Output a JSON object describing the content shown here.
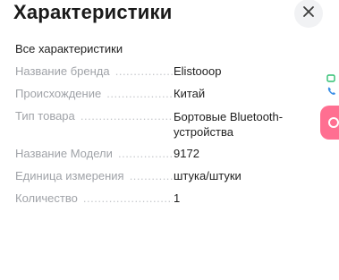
{
  "header": {
    "title": "Характеристики"
  },
  "section": {
    "title": "Все характеристики"
  },
  "specs": [
    {
      "label": "Название бренда",
      "value": "Elistooop"
    },
    {
      "label": "Происхождение",
      "value": "Китай"
    },
    {
      "label": "Тип товара",
      "value": "Бортовые Bluetooth-устройства"
    },
    {
      "label": "Название Модели",
      "value": "9172"
    },
    {
      "label": "Единица измерения",
      "value": "штука/штуки"
    },
    {
      "label": "Количество",
      "value": "1"
    }
  ],
  "colors": {
    "label_gray": "#a0a3a8",
    "value_dark": "#1f1f1f",
    "close_bg": "#f1f2f4",
    "fab_pink": "#ff6f91",
    "chat_green": "#2fbf71",
    "phone_blue": "#3a8ee6"
  },
  "icons": {
    "close": "close-icon",
    "chat": "chat-icon",
    "phone": "phone-icon",
    "fab": "service-icon"
  }
}
